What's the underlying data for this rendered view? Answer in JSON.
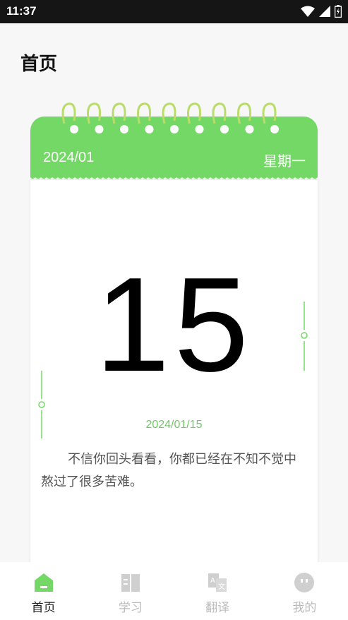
{
  "status_bar": {
    "time": "11:37"
  },
  "page": {
    "title": "首页"
  },
  "calendar": {
    "month": "2024/01",
    "weekday": "星期一",
    "day": "15",
    "full_date": "2024/01/15",
    "quote": "不信你回头看看，你都已经在不知不觉中熬过了很多苦难。"
  },
  "colors": {
    "accent": "#74d866",
    "ring": "#b9dc6a",
    "inactive": "#bbbbbb"
  },
  "nav": [
    {
      "label": "首页",
      "icon": "home-icon",
      "active": true
    },
    {
      "label": "学习",
      "icon": "book-icon",
      "active": false
    },
    {
      "label": "翻译",
      "icon": "translate-icon",
      "active": false
    },
    {
      "label": "我的",
      "icon": "profile-icon",
      "active": false
    }
  ]
}
